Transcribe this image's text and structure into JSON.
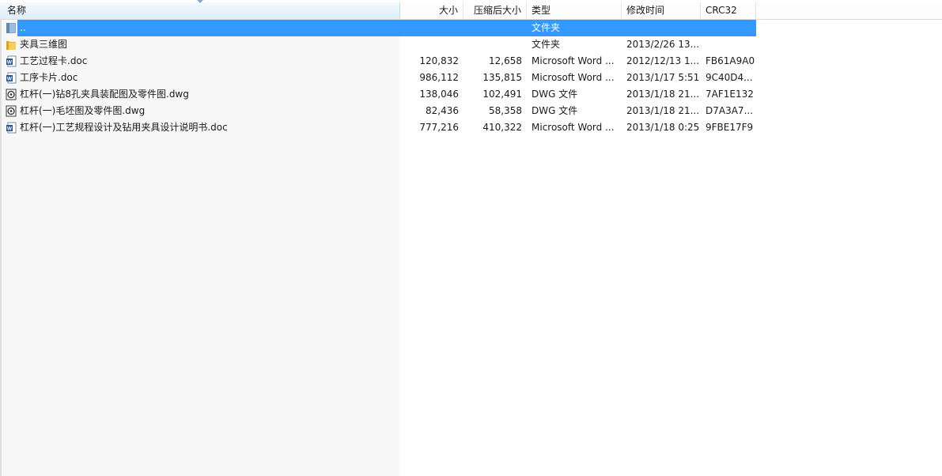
{
  "columns": {
    "name": "名称",
    "size": "大小",
    "packed": "压缩后大小",
    "type": "类型",
    "modified": "修改时间",
    "crc": "CRC32"
  },
  "rows": [
    {
      "icon": "parent-folder-icon",
      "name": "..",
      "size": "",
      "packed": "",
      "type": "文件夹",
      "modified": "",
      "crc": "",
      "selected": true
    },
    {
      "icon": "folder-icon",
      "name": "夹具三维图",
      "size": "",
      "packed": "",
      "type": "文件夹",
      "modified": "2013/2/26 13...",
      "crc": "",
      "selected": false
    },
    {
      "icon": "word-doc-icon",
      "name": "工艺过程卡.doc",
      "size": "120,832",
      "packed": "12,658",
      "type": "Microsoft Word ...",
      "modified": "2012/12/13 1...",
      "crc": "FB61A9A0",
      "selected": false
    },
    {
      "icon": "word-doc-icon",
      "name": "工序卡片.doc",
      "size": "986,112",
      "packed": "135,815",
      "type": "Microsoft Word ...",
      "modified": "2013/1/17 5:51",
      "crc": "9C40D4...",
      "selected": false
    },
    {
      "icon": "dwg-file-icon",
      "name": "杠杆(一)钻8孔夹具装配图及零件图.dwg",
      "size": "138,046",
      "packed": "102,491",
      "type": "DWG 文件",
      "modified": "2013/1/18 21...",
      "crc": "7AF1E132",
      "selected": false
    },
    {
      "icon": "dwg-file-icon",
      "name": "杠杆(一)毛坯图及零件图.dwg",
      "size": "82,436",
      "packed": "58,358",
      "type": "DWG 文件",
      "modified": "2013/1/18 21...",
      "crc": "D7A3A7...",
      "selected": false
    },
    {
      "icon": "word-doc-icon",
      "name": "杠杆(一)工艺规程设计及钻用夹具设计说明书.doc",
      "size": "777,216",
      "packed": "410,322",
      "type": "Microsoft Word ...",
      "modified": "2013/1/18 0:25",
      "crc": "9FBE17F9",
      "selected": false
    }
  ],
  "colors": {
    "selection": "#3399ff",
    "header_name_bg": "#dfeefa",
    "folder": "#f0c24b",
    "word": "#2b5797",
    "dwg": "#3a3a3a"
  }
}
